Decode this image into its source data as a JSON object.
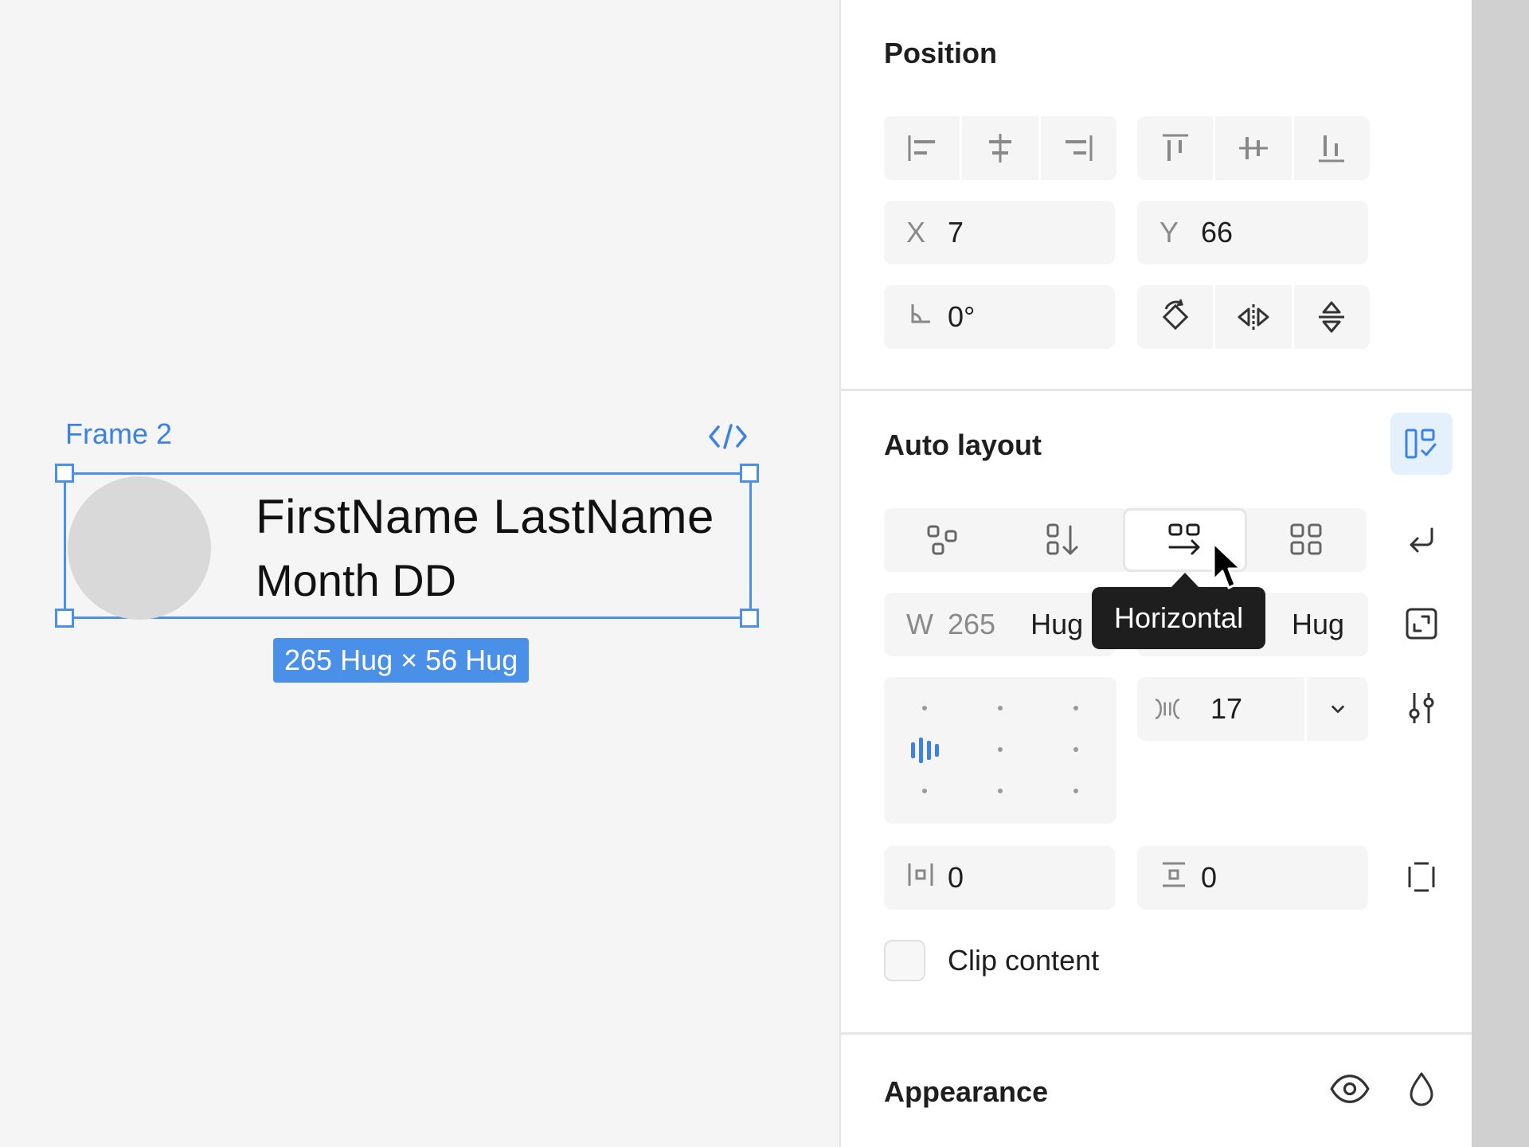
{
  "canvas": {
    "frame_label": "Frame 2",
    "name_text": "FirstName LastName",
    "date_text": "Month DD",
    "size_badge": "265 Hug × 56 Hug"
  },
  "panel": {
    "position": {
      "title": "Position",
      "x_label": "X",
      "x_value": "7",
      "y_label": "Y",
      "y_value": "66",
      "rotation_value": "0°"
    },
    "auto_layout": {
      "title": "Auto layout",
      "direction_tooltip": "Horizontal",
      "width_label": "W",
      "width_value": "265",
      "width_mode": "Hug",
      "height_mode": "Hug",
      "gap_value": "17",
      "padding_horizontal": "0",
      "padding_vertical": "0",
      "clip_content_label": "Clip content"
    },
    "appearance": {
      "title": "Appearance"
    }
  },
  "colors": {
    "accent": "#4a90e8",
    "panel_bg": "#ffffff",
    "canvas_bg": "#f5f5f5",
    "tooltip_bg": "#1e1e1e"
  }
}
